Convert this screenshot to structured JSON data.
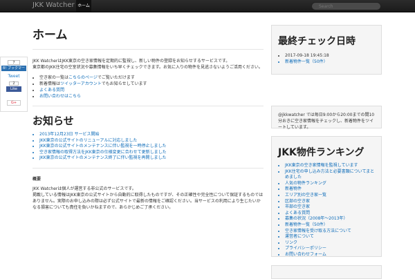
{
  "navbar": {
    "brand": "JKK Watcher",
    "active_item": "ホーム",
    "search_placeholder": "Search"
  },
  "social": {
    "hatena_count": "7",
    "hatena_label": "B! ブックマーク",
    "tweet_label": "Tweet",
    "fb_count": "2",
    "fb_label": "Like",
    "gplus_label": "G+"
  },
  "main": {
    "title": "ホーム",
    "intro_line1": "JKK WatcherはJKK東京の空き家情報を定期的に監視し、新しい物件の登録をお知らせするサービスです。",
    "intro_line2": "東京都のJKK住宅の空室状況や募集情報をいち早くチェックできます。お気に入りの物件を見逃さないようご活用ください。",
    "features": [
      {
        "text_before": "空き家の一覧は",
        "link": "こちらのページ",
        "text_after": "でご覧いただけます"
      },
      {
        "text_before": "新着情報は",
        "link": "ツイッターアカウント",
        "text_after": "でもお知らせしています"
      },
      {
        "text_before": "",
        "link": "よくある質問",
        "text_after": ""
      },
      {
        "text_before": "",
        "link": "お問い合わせはこちら",
        "text_after": ""
      }
    ],
    "news_title": "お知らせ",
    "news": [
      "2013年12月23日 サービス開始",
      "JKK東京の公式サイトのリニューアルに対応しました",
      "JKK東京の公式サイトのメンテナンスに伴い監視を一時停止しました",
      "空き家情報の取得方法をJKK東京の仕様変更に合わせて更新しました",
      "JKK東京の公式サイトのメンテナンス終了に伴い監視を再開しました"
    ],
    "about_title": "概要",
    "about_line1": "JKK Watcherは個人が運営する非公式のサービスです。",
    "about_line2": "掲載している情報はJKK東京の公式サイトから自動的に取得したものですが、その正確性や完全性について保証するものではありません。実際のお申し込みの際は必ず公式サイトで最新の情報をご確認ください。当サービスの利用により生じたいかなる損害についても責任を負いかねますので、あらかじめご了承ください。"
  },
  "sidebar": {
    "update_title": "最終チェック日時",
    "update_items": [
      "2017-09-18 19:45:18",
      "新着物件一覧（50件）"
    ],
    "twitter_text": "@jkkwatcher では毎日9:00から20:00までの間10分おきに空き家情報をチェックし、新着物件をツイートしています。",
    "twitter_handle": "@jkkwatcher",
    "popular_title": "JKK物件ランキング",
    "popular_items": [
      "JKK東京の空き家情報を監視しています",
      "JKK住宅の申し込み方法と必要書類についてまとめました",
      "人気の物件ランキング",
      "新着物件",
      "エリア別の空き家一覧",
      "区部の空き家",
      "市部の空き家",
      "よくある質問",
      "募集の状況（2008年〜2013年）",
      "新着物件一覧（50件）",
      "空き家情報を受け取る方法について",
      "運営者について",
      "リンク",
      "プライバシーポリシー",
      "お問い合わせフォーム"
    ]
  }
}
